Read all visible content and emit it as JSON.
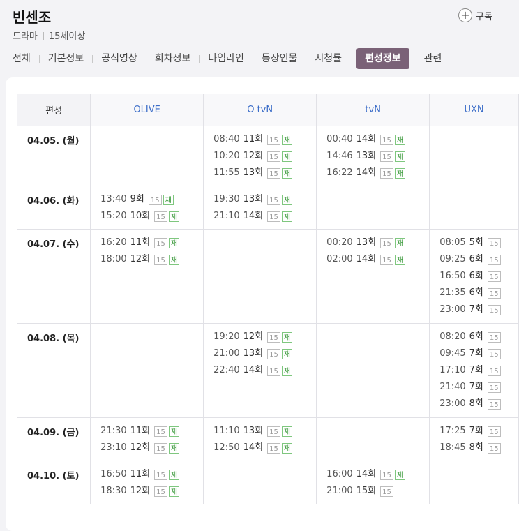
{
  "title": "빈센조",
  "meta": {
    "genre": "드라마",
    "rating": "15세이상"
  },
  "subscribe_label": "구독",
  "tabs": [
    "전체",
    "기본정보",
    "공식영상",
    "회차정보",
    "타임라인",
    "등장인물",
    "시청률",
    "편성정보",
    "관련"
  ],
  "active_tab": 7,
  "schedule": {
    "corner_label": "편성",
    "channels": [
      "OLIVE",
      "O tvN",
      "tvN",
      "UXN"
    ],
    "badge_rating": "15",
    "badge_rerun": "재",
    "rows": [
      {
        "date": "04.05. (월)",
        "cells": [
          [],
          [
            {
              "time": "08:40",
              "ep": "11회",
              "re": true
            },
            {
              "time": "10:20",
              "ep": "12회",
              "re": true
            },
            {
              "time": "11:55",
              "ep": "13회",
              "re": true
            }
          ],
          [
            {
              "time": "00:40",
              "ep": "14회",
              "re": true
            },
            {
              "time": "14:46",
              "ep": "13회",
              "re": true
            },
            {
              "time": "16:22",
              "ep": "14회",
              "re": true
            }
          ],
          []
        ]
      },
      {
        "date": "04.06. (화)",
        "cells": [
          [
            {
              "time": "13:40",
              "ep": "9회",
              "re": true
            },
            {
              "time": "15:20",
              "ep": "10회",
              "re": true
            }
          ],
          [
            {
              "time": "19:30",
              "ep": "13회",
              "re": true
            },
            {
              "time": "21:10",
              "ep": "14회",
              "re": true
            }
          ],
          [],
          []
        ]
      },
      {
        "date": "04.07. (수)",
        "cells": [
          [
            {
              "time": "16:20",
              "ep": "11회",
              "re": true
            },
            {
              "time": "18:00",
              "ep": "12회",
              "re": true
            }
          ],
          [],
          [
            {
              "time": "00:20",
              "ep": "13회",
              "re": true
            },
            {
              "time": "02:00",
              "ep": "14회",
              "re": true
            }
          ],
          [
            {
              "time": "08:05",
              "ep": "5회",
              "re": false
            },
            {
              "time": "09:25",
              "ep": "6회",
              "re": false
            },
            {
              "time": "16:50",
              "ep": "6회",
              "re": false
            },
            {
              "time": "21:35",
              "ep": "6회",
              "re": false
            },
            {
              "time": "23:00",
              "ep": "7회",
              "re": false
            }
          ]
        ]
      },
      {
        "date": "04.08. (목)",
        "cells": [
          [],
          [
            {
              "time": "19:20",
              "ep": "12회",
              "re": true
            },
            {
              "time": "21:00",
              "ep": "13회",
              "re": true
            },
            {
              "time": "22:40",
              "ep": "14회",
              "re": true
            }
          ],
          [],
          [
            {
              "time": "08:20",
              "ep": "6회",
              "re": false
            },
            {
              "time": "09:45",
              "ep": "7회",
              "re": false
            },
            {
              "time": "17:10",
              "ep": "7회",
              "re": false
            },
            {
              "time": "21:40",
              "ep": "7회",
              "re": false
            },
            {
              "time": "23:00",
              "ep": "8회",
              "re": false
            }
          ]
        ]
      },
      {
        "date": "04.09. (금)",
        "cells": [
          [
            {
              "time": "21:30",
              "ep": "11회",
              "re": true
            },
            {
              "time": "23:10",
              "ep": "12회",
              "re": true
            }
          ],
          [
            {
              "time": "11:10",
              "ep": "13회",
              "re": true
            },
            {
              "time": "12:50",
              "ep": "14회",
              "re": true
            }
          ],
          [],
          [
            {
              "time": "17:25",
              "ep": "7회",
              "re": false
            },
            {
              "time": "18:45",
              "ep": "8회",
              "re": false
            }
          ]
        ]
      },
      {
        "date": "04.10. (토)",
        "cells": [
          [
            {
              "time": "16:50",
              "ep": "11회",
              "re": true
            },
            {
              "time": "18:30",
              "ep": "12회",
              "re": true
            }
          ],
          [],
          [
            {
              "time": "16:00",
              "ep": "14회",
              "re": true
            },
            {
              "time": "21:00",
              "ep": "15회",
              "re": false
            }
          ],
          []
        ]
      }
    ]
  },
  "colors": {
    "accent_tab": "#7a6177",
    "channel_text": "#3a6cc8",
    "rerun_badge": "#3c9a3c"
  }
}
